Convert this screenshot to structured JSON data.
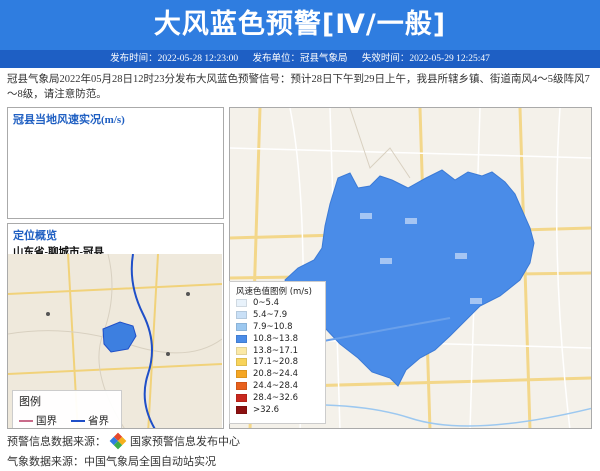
{
  "header": {
    "title": "大风蓝色预警[Ⅳ/一般]",
    "publish_time": "发布时间：2022-05-28 12:23:00",
    "publisher": "发布单位：冠县气象局",
    "expire_time": "失效时间：2022-05-29 12:25:47"
  },
  "description": "冠县气象局2022年05月28日12时23分发布大风蓝色预警信号：预计28日下午到29日上午，我县所辖乡镇、街道南风4～5级阵风7～8级，请注意防范。",
  "wind_panel": {
    "title": "冠县当地风速实况(m/s)"
  },
  "location_panel": {
    "title": "定位概览",
    "region": "山东省-聊城市-冠县",
    "legend_title": "图例",
    "legend_items": [
      {
        "label": "国界",
        "color": "#c96b8a"
      },
      {
        "label": "省界",
        "color": "#1f4fc8"
      }
    ]
  },
  "wind_legend": {
    "title": "风速色值图例 (m/s)",
    "items": [
      {
        "label": "0~5.4",
        "color": "#e8f2fb"
      },
      {
        "label": "5.4~7.9",
        "color": "#c9e0f7"
      },
      {
        "label": "7.9~10.8",
        "color": "#9cc8f0"
      },
      {
        "label": "10.8~13.8",
        "color": "#4a8ce8"
      },
      {
        "label": "13.8~17.1",
        "color": "#fbe9a6"
      },
      {
        "label": "17.1~20.8",
        "color": "#f8d35a"
      },
      {
        "label": "20.8~24.4",
        "color": "#f5a623"
      },
      {
        "label": "24.4~28.4",
        "color": "#e8601c"
      },
      {
        "label": "28.4~32.6",
        "color": "#c8281e"
      },
      {
        "label": ">32.6",
        "color": "#8c1010"
      }
    ]
  },
  "sources": {
    "warning": "预警信息数据来源：",
    "warning_org": "国家预警信息发布中心",
    "weather": "气象数据来源：中国气象局全国自动站实况"
  },
  "colors": {
    "header_bg": "#2f7de0",
    "infobar_bg": "#1e5fc4",
    "warning_area": "#4a8ce8"
  }
}
